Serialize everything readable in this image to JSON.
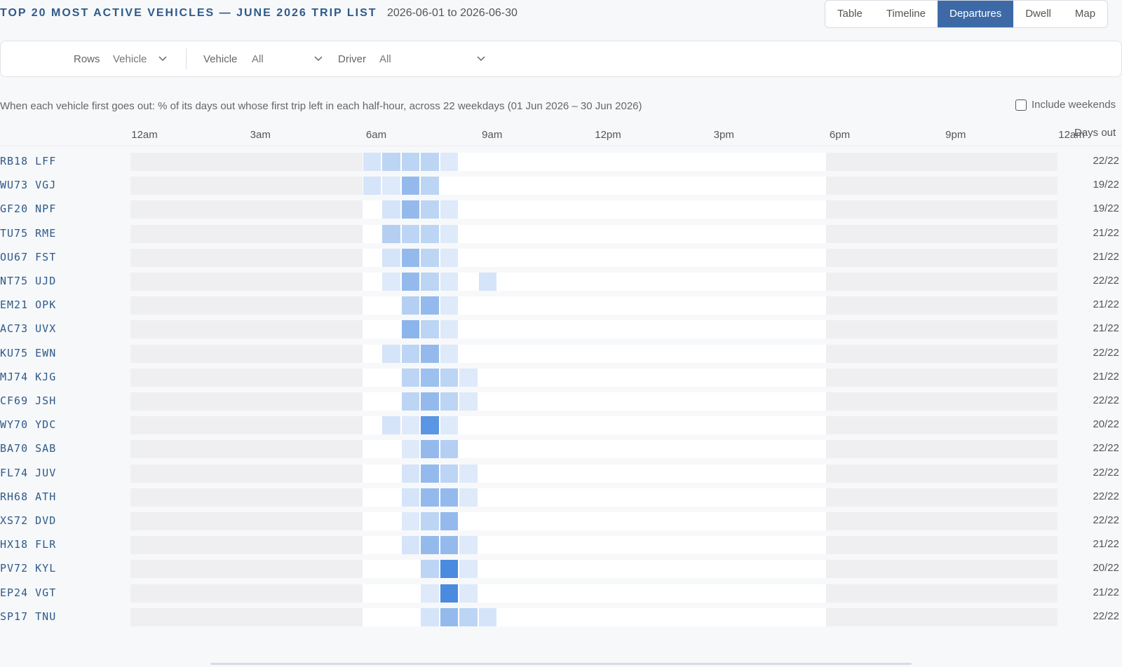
{
  "header": {
    "title": "TOP 20 MOST ACTIVE VEHICLES — JUNE 2026 TRIP LIST",
    "date_range": "2026-06-01 to 2026-06-30"
  },
  "views": [
    {
      "label": "Table",
      "active": false
    },
    {
      "label": "Timeline",
      "active": false
    },
    {
      "label": "Departures",
      "active": true
    },
    {
      "label": "Dwell",
      "active": false
    },
    {
      "label": "Map",
      "active": false
    }
  ],
  "filters": {
    "rows_label": "Rows",
    "rows_value": "Vehicle",
    "vehicle_label": "Vehicle",
    "vehicle_value": "All",
    "driver_label": "Driver",
    "driver_value": "All"
  },
  "description": "When each vehicle first goes out: % of its days out whose first trip left in each half-hour, across 22 weekdays (01 Jun 2026 – 30 Jun 2026)",
  "include_weekends": {
    "label": "Include weekends",
    "checked": false
  },
  "axis_ticks": [
    "12am",
    "3am",
    "6am",
    "9am",
    "12pm",
    "3pm",
    "6pm",
    "9pm",
    "12am"
  ],
  "days_out_header": "Days out",
  "colors": {
    "accent": "#3d6aa6",
    "heat_max": "#4a8be0",
    "heat_min": "#eef4fd"
  },
  "rows": [
    {
      "vehicle": "RB18 LFF",
      "days_out": "22/22",
      "levels": {
        "12": 0.15,
        "13": 0.3,
        "14": 0.3,
        "15": 0.3,
        "16": 0.1
      }
    },
    {
      "vehicle": "WU73 VGJ",
      "days_out": "19/22",
      "levels": {
        "12": 0.15,
        "13": 0.1,
        "14": 0.55,
        "15": 0.3
      }
    },
    {
      "vehicle": "GF20 NPF",
      "days_out": "19/22",
      "levels": {
        "13": 0.15,
        "14": 0.55,
        "15": 0.3,
        "16": 0.1
      }
    },
    {
      "vehicle": "TU75 RME",
      "days_out": "21/22",
      "levels": {
        "13": 0.35,
        "14": 0.3,
        "15": 0.3,
        "16": 0.1
      }
    },
    {
      "vehicle": "OU67 FST",
      "days_out": "21/22",
      "levels": {
        "13": 0.15,
        "14": 0.55,
        "15": 0.3,
        "16": 0.1
      }
    },
    {
      "vehicle": "NT75 UJD",
      "days_out": "22/22",
      "levels": {
        "13": 0.1,
        "14": 0.55,
        "15": 0.3,
        "16": 0.1,
        "18": 0.15
      }
    },
    {
      "vehicle": "EM21 OPK",
      "days_out": "21/22",
      "levels": {
        "14": 0.35,
        "15": 0.55,
        "16": 0.1
      }
    },
    {
      "vehicle": "AC73 UVX",
      "days_out": "21/22",
      "levels": {
        "14": 0.6,
        "15": 0.3,
        "16": 0.1
      }
    },
    {
      "vehicle": "KU75 EWN",
      "days_out": "22/22",
      "levels": {
        "13": 0.15,
        "14": 0.3,
        "15": 0.55,
        "16": 0.1
      }
    },
    {
      "vehicle": "MJ74 KJG",
      "days_out": "21/22",
      "levels": {
        "14": 0.3,
        "15": 0.5,
        "16": 0.3,
        "17": 0.1
      }
    },
    {
      "vehicle": "CF69 JSH",
      "days_out": "22/22",
      "levels": {
        "14": 0.3,
        "15": 0.55,
        "16": 0.3,
        "17": 0.1
      }
    },
    {
      "vehicle": "WY70 YDC",
      "days_out": "20/22",
      "levels": {
        "13": 0.15,
        "14": 0.1,
        "15": 0.9,
        "16": 0.1
      }
    },
    {
      "vehicle": "BA70 SAB",
      "days_out": "22/22",
      "levels": {
        "14": 0.1,
        "15": 0.55,
        "16": 0.35
      }
    },
    {
      "vehicle": "FL74 JUV",
      "days_out": "22/22",
      "levels": {
        "14": 0.15,
        "15": 0.55,
        "16": 0.3,
        "17": 0.1
      }
    },
    {
      "vehicle": "RH68 ATH",
      "days_out": "22/22",
      "levels": {
        "14": 0.15,
        "15": 0.55,
        "16": 0.55,
        "17": 0.1
      }
    },
    {
      "vehicle": "XS72 DVD",
      "days_out": "22/22",
      "levels": {
        "14": 0.1,
        "15": 0.3,
        "16": 0.55
      }
    },
    {
      "vehicle": "HX18 FLR",
      "days_out": "21/22",
      "levels": {
        "14": 0.15,
        "15": 0.55,
        "16": 0.55,
        "17": 0.1
      }
    },
    {
      "vehicle": "PV72 KYL",
      "days_out": "20/22",
      "levels": {
        "15": 0.3,
        "16": 1.0,
        "17": 0.1
      }
    },
    {
      "vehicle": "EP24 VGT",
      "days_out": "21/22",
      "levels": {
        "15": 0.1,
        "16": 1.0,
        "17": 0.1
      }
    },
    {
      "vehicle": "SP17 TNU",
      "days_out": "22/22",
      "levels": {
        "15": 0.15,
        "16": 0.55,
        "17": 0.3,
        "18": 0.15
      }
    }
  ]
}
